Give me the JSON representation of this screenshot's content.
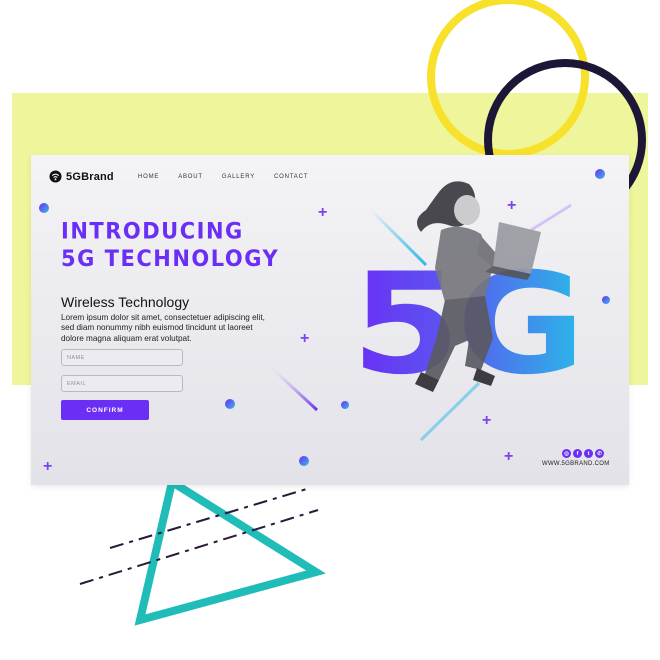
{
  "brand": {
    "name": "5GBrand"
  },
  "nav": {
    "items": [
      "HOME",
      "ABOUT",
      "GALLERY",
      "CONTACT"
    ]
  },
  "hero": {
    "headline_line1": "INTRODUCING",
    "headline_line2": "5G TECHNOLOGY",
    "subtitle": "Wireless Technology",
    "body": "Lorem ipsum dolor sit amet, consectetuer adipiscing elit, sed diam nonummy nibh euismod tincidunt ut laoreet dolore magna aliquam erat volutpat.",
    "big_text": "5G"
  },
  "form": {
    "name_placeholder": "NAME",
    "email_placeholder": "EMAIL",
    "confirm_label": "CONFIRM"
  },
  "footer": {
    "social_icons": [
      "instagram-icon",
      "facebook-icon",
      "twitter-icon",
      "whatsapp-icon"
    ],
    "url": "WWW.5GBRAND.COM"
  },
  "colors": {
    "accent": "#6b2ef5",
    "cyan": "#2ab8e8",
    "yellow_backdrop": "#eef59a",
    "ring_yellow": "#f7e12a",
    "ring_dark": "#1e1636",
    "triangle_teal": "#1fbcb8"
  }
}
